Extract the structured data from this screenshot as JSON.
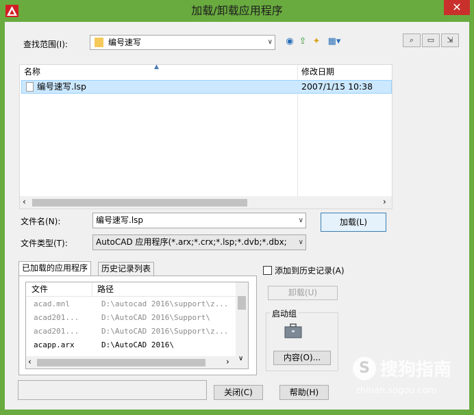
{
  "window": {
    "title": "加载/卸载应用程序",
    "close_glyph": "✕"
  },
  "look_in": {
    "label": "查找范围(I):",
    "value": "编号速写"
  },
  "toolbar_icons": [
    "back-icon",
    "up-folder-icon",
    "new-folder-icon",
    "views-menu-icon"
  ],
  "right_icons": [
    "find-icon",
    "folder-icon",
    "export-icon"
  ],
  "file_list": {
    "columns": [
      "名称",
      "修改日期"
    ],
    "rows": [
      {
        "name": "编号速写.lsp",
        "date": "2007/1/15 10:38"
      }
    ]
  },
  "file_name": {
    "label": "文件名(N):",
    "value": "编号速写.lsp"
  },
  "file_type": {
    "label": "文件类型(T):",
    "value": "AutoCAD 应用程序(*.arx;*.crx;*.lsp;*.dvb;*.dbx;"
  },
  "load_button": "加载(L)",
  "tabs": [
    "已加载的应用程序",
    "历史记录列表"
  ],
  "app_list": {
    "columns": [
      "文件",
      "路径"
    ],
    "rows": [
      {
        "file": "acad.mnl",
        "path": "D:\\autocad 2016\\support\\z...",
        "dim": true
      },
      {
        "file": "acad201...",
        "path": "D:\\AutoCAD 2016\\Support\\",
        "dim": true
      },
      {
        "file": "acad201...",
        "path": "D:\\AutoCAD 2016\\Support\\z...",
        "dim": true
      },
      {
        "file": "acapp.arx",
        "path": "D:\\AutoCAD 2016\\",
        "dim": false
      }
    ]
  },
  "add_history": {
    "label": "添加到历史记录(A)",
    "checked": false
  },
  "unload_button": "卸载(U)",
  "startup_group": {
    "label": "启动组",
    "contents_button": "内容(O)..."
  },
  "close_button": "关闭(C)",
  "help_button": "帮助(H)",
  "watermark": {
    "brand": "搜狗指南",
    "url": "zhinan.sogou.com"
  },
  "colors": {
    "title_bar": "#6aab3f",
    "selection": "#cce8ff",
    "close": "#c9302c"
  }
}
